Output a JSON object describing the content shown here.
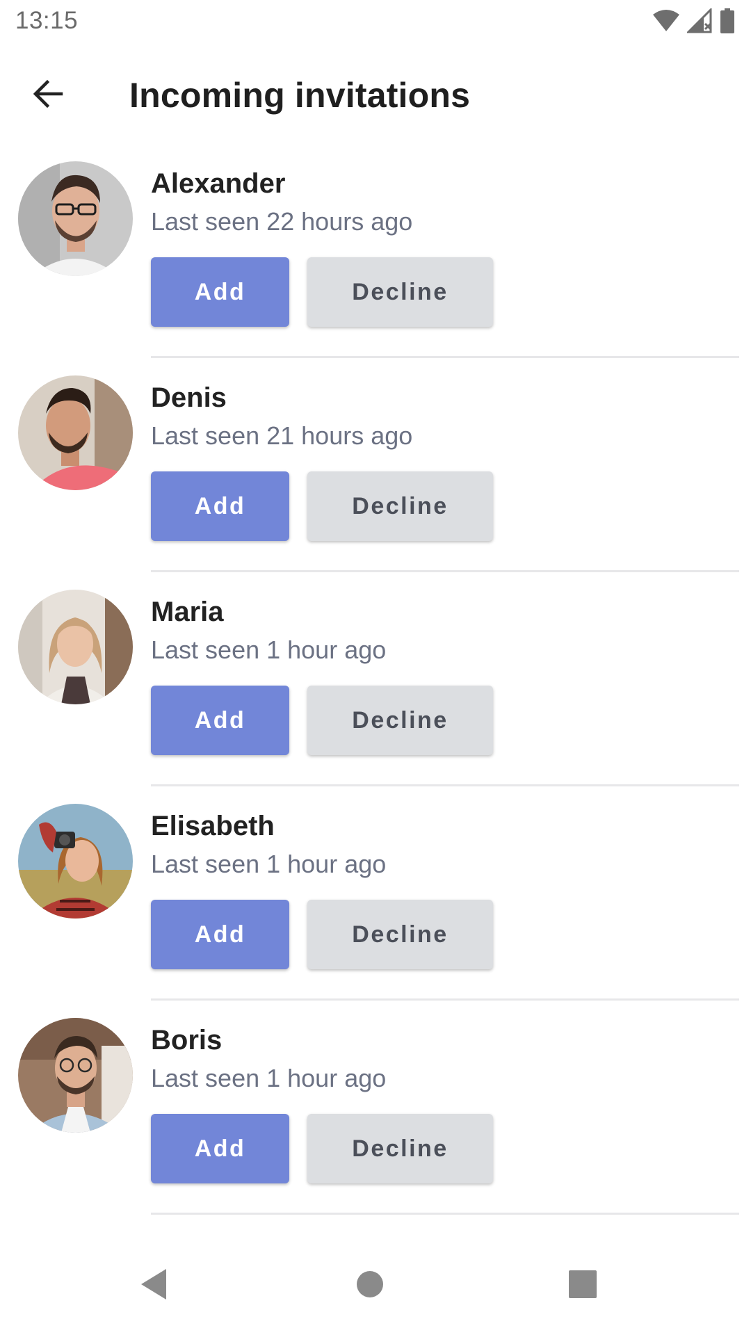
{
  "status_bar": {
    "time": "13:15",
    "icons": [
      "wifi-icon",
      "cellular-signal-icon",
      "battery-icon"
    ]
  },
  "app_bar": {
    "back_icon": "arrow-back-icon",
    "title": "Incoming invitations"
  },
  "invitations": [
    {
      "name": "Alexander",
      "status": "Last seen 22 hours ago",
      "add_label": "Add",
      "decline_label": "Decline"
    },
    {
      "name": "Denis",
      "status": "Last seen 21 hours ago",
      "add_label": "Add",
      "decline_label": "Decline"
    },
    {
      "name": "Maria",
      "status": "Last seen 1 hour ago",
      "add_label": "Add",
      "decline_label": "Decline"
    },
    {
      "name": "Elisabeth",
      "status": "Last seen 1 hour ago",
      "add_label": "Add",
      "decline_label": "Decline"
    },
    {
      "name": "Boris",
      "status": "Last seen 1 hour ago",
      "add_label": "Add",
      "decline_label": "Decline"
    }
  ],
  "nav_bar": {
    "icons": [
      "nav-back-icon",
      "nav-home-icon",
      "nav-recents-icon"
    ]
  },
  "colors": {
    "add_button": "#7286d8",
    "decline_button": "#dcdee1",
    "status_text": "#6b7183"
  }
}
